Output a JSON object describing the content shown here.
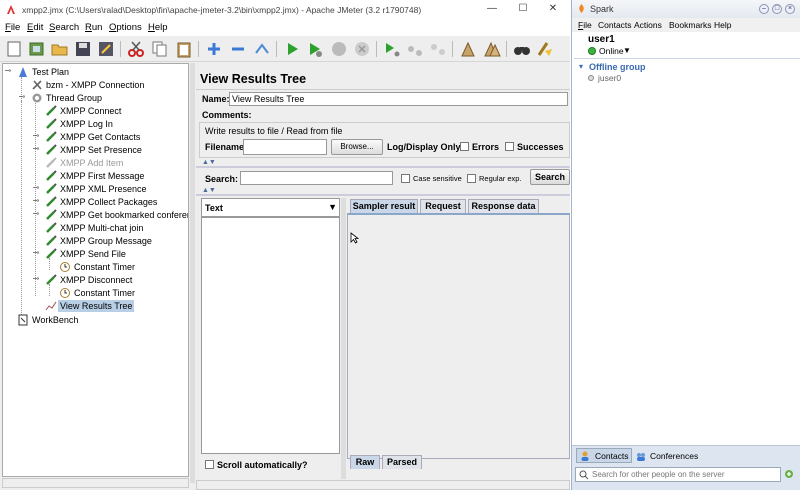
{
  "jmeter": {
    "title": "xmpp2.jmx (C:\\Users\\ralad\\Desktop\\fin\\apache-jmeter-3.2\\bin\\xmpp2.jmx) - Apache JMeter (3.2 r1790748)",
    "menu": [
      "File",
      "Edit",
      "Search",
      "Run",
      "Options",
      "Help"
    ],
    "tree": [
      {
        "label": "Test Plan"
      },
      {
        "label": "bzm - XMPP Connection"
      },
      {
        "label": "Thread Group"
      },
      {
        "label": "XMPP Connect"
      },
      {
        "label": "XMPP Log In"
      },
      {
        "label": "XMPP Get Contacts"
      },
      {
        "label": "XMPP Set Presence"
      },
      {
        "label": "XMPP Add Item"
      },
      {
        "label": "XMPP First Message"
      },
      {
        "label": "XMPP XML Presence"
      },
      {
        "label": "XMPP Collect Packages"
      },
      {
        "label": "XMPP Get bookmarked conferences"
      },
      {
        "label": "XMPP Multi-chat join"
      },
      {
        "label": "XMPP Group Message"
      },
      {
        "label": "XMPP Send File"
      },
      {
        "label": "Constant Timer"
      },
      {
        "label": "XMPP Disconnect"
      },
      {
        "label": "Constant Timer"
      },
      {
        "label": "View Results Tree"
      },
      {
        "label": "WorkBench"
      }
    ],
    "panel": {
      "heading": "View Results Tree",
      "name_label": "Name:",
      "name_value": "View Results Tree",
      "comments_label": "Comments:",
      "write_section": "Write results to file / Read from file",
      "filename_label": "Filename",
      "browse_label": "Browse...",
      "log_display_label": "Log/Display Only:",
      "errors_label": "Errors",
      "successes_label": "Successes",
      "search_label": "Search:",
      "case_sensitive_label": "Case sensitive",
      "regular_exp_label": "Regular exp.",
      "search_button": "Search",
      "renderer_value": "Text",
      "tabs": [
        "Sampler result",
        "Request",
        "Response data"
      ],
      "scroll_auto_label": "Scroll automatically?",
      "bottom_tabs": [
        "Raw",
        "Parsed"
      ]
    }
  },
  "spark": {
    "title": "Spark",
    "menu": [
      "File",
      "Contacts",
      "Actions",
      "Bookmarks",
      "Help"
    ],
    "username": "user1",
    "status": "Online",
    "group": "Offline group",
    "contact": "juser0",
    "bottom_tabs": [
      "Contacts",
      "Conferences"
    ],
    "search_placeholder": "Search for other people on the server"
  }
}
